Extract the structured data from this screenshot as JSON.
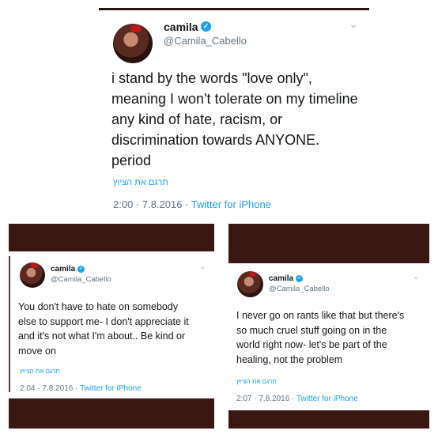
{
  "top": {
    "name": "camila",
    "handle": "@Camila_Cabello",
    "lines": [
      "i stand by the words \"love only\",",
      "meaning I won't tolerate on my timeline",
      "any kind of hate, racism, or",
      "discrimination towards ANYONE.",
      "period"
    ],
    "translate": "תרגם את הציוץ",
    "time": "2:00 · 7.8.2016 · ",
    "source": "Twitter for iPhone"
  },
  "left": {
    "name": "camila",
    "handle": "@Camila_Cabello",
    "lines": [
      "You don't have to hate on somebody",
      "else to support me- I don't appreciate it",
      "and it's not what I'm about.. Be kind or",
      "move on"
    ],
    "translate": "תרגם את הציוץ",
    "time": "2:04 · 7.8.2016 · ",
    "source": "Twitter for iPhone"
  },
  "right": {
    "name": "camila",
    "handle": "@Camila_Cabello",
    "lines": [
      "I never go on rants like that but there's",
      "so much cruel stuff going on in the",
      "world right now- let's be part of the",
      "healing, not the problem"
    ],
    "translate": "תרגם את הציוץ",
    "time": "2:07 · 7.8.2016 · ",
    "source": "Twitter for iPhone"
  },
  "icons": {
    "verified": "✓",
    "chevron": "⌄"
  },
  "colors": {
    "bar": "#3b1714",
    "link": "#1da1f2",
    "muted": "#657786"
  }
}
